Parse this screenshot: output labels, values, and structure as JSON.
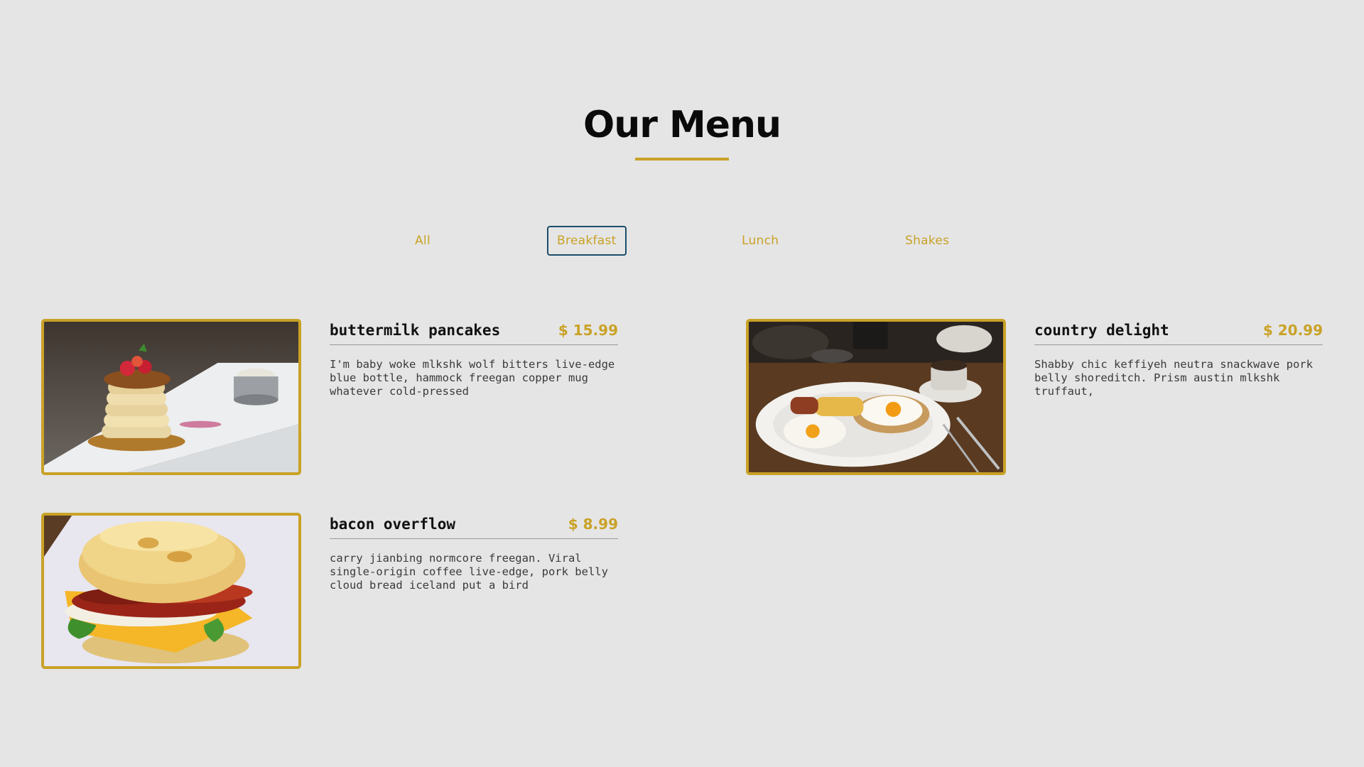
{
  "page": {
    "title": "Our Menu",
    "accent_color": "#c9a227",
    "background_color": "#e5e5e5"
  },
  "filters": [
    {
      "label": "All",
      "active": false
    },
    {
      "label": "Breakfast",
      "active": true
    },
    {
      "label": "Lunch",
      "active": false
    },
    {
      "label": "Shakes",
      "active": false
    }
  ],
  "menu_items": [
    {
      "name": "buttermilk pancakes",
      "price": "$ 15.99",
      "description": "I'm baby woke mlkshk wolf bitters live-edge blue bottle, hammock freegan copper mug whatever cold-pressed",
      "image": "pancake-stack-photo"
    },
    {
      "name": "country delight",
      "price": "$ 20.99",
      "description": "Shabby chic keffiyeh neutra snackwave pork belly shoreditch. Prism austin mlkshk truffaut,",
      "image": "eggs-and-toast-photo"
    },
    {
      "name": "bacon overflow",
      "price": "$ 8.99",
      "description": "carry jianbing normcore freegan. Viral single-origin coffee live-edge, pork belly cloud bread iceland put a bird",
      "image": "bacon-biscuit-sandwich-photo"
    }
  ]
}
